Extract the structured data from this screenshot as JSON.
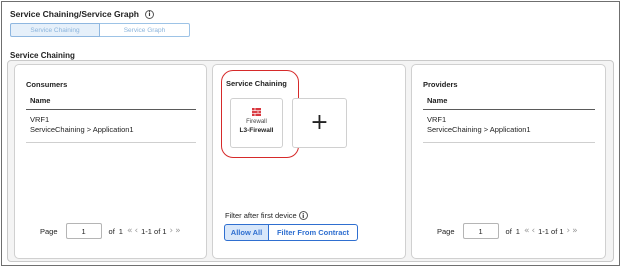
{
  "header": {
    "title": "Service Chaining/Service Graph"
  },
  "view_toggle": {
    "options": [
      "Service Chaining",
      "Service Graph"
    ],
    "selected": "Service Chaining"
  },
  "section": {
    "label": "Service Chaining"
  },
  "consumers": {
    "title": "Consumers",
    "column": "Name",
    "rows": [
      {
        "line1": "VRF1",
        "line2": "ServiceChaining > Application1"
      }
    ],
    "pager": {
      "label": "Page",
      "page": "1",
      "of_label": "of",
      "total": "1",
      "first": "«",
      "prev": "‹",
      "range": "1-1 of 1",
      "next": "›",
      "last": "»"
    }
  },
  "chain": {
    "title": "Service Chaining",
    "device": {
      "type": "Firewall",
      "name": "L3-Firewall",
      "icon": "firewall-icon"
    },
    "add_symbol": "+",
    "filter_label": "Filter after first device",
    "filter_options": [
      "Allow All",
      "Filter From Contract"
    ],
    "filter_selected": "Allow All"
  },
  "providers": {
    "title": "Providers",
    "column": "Name",
    "rows": [
      {
        "line1": "VRF1",
        "line2": "ServiceChaining > Application1"
      }
    ],
    "pager": {
      "label": "Page",
      "page": "1",
      "of_label": "of",
      "total": "1",
      "first": "«",
      "prev": "‹",
      "range": "1-1 of 1",
      "next": "›",
      "last": "»"
    }
  },
  "info_symbol": "i",
  "colors": {
    "accent": "#2f6fd0",
    "highlight": "#d62a2a",
    "firewall": "#d9363e"
  }
}
